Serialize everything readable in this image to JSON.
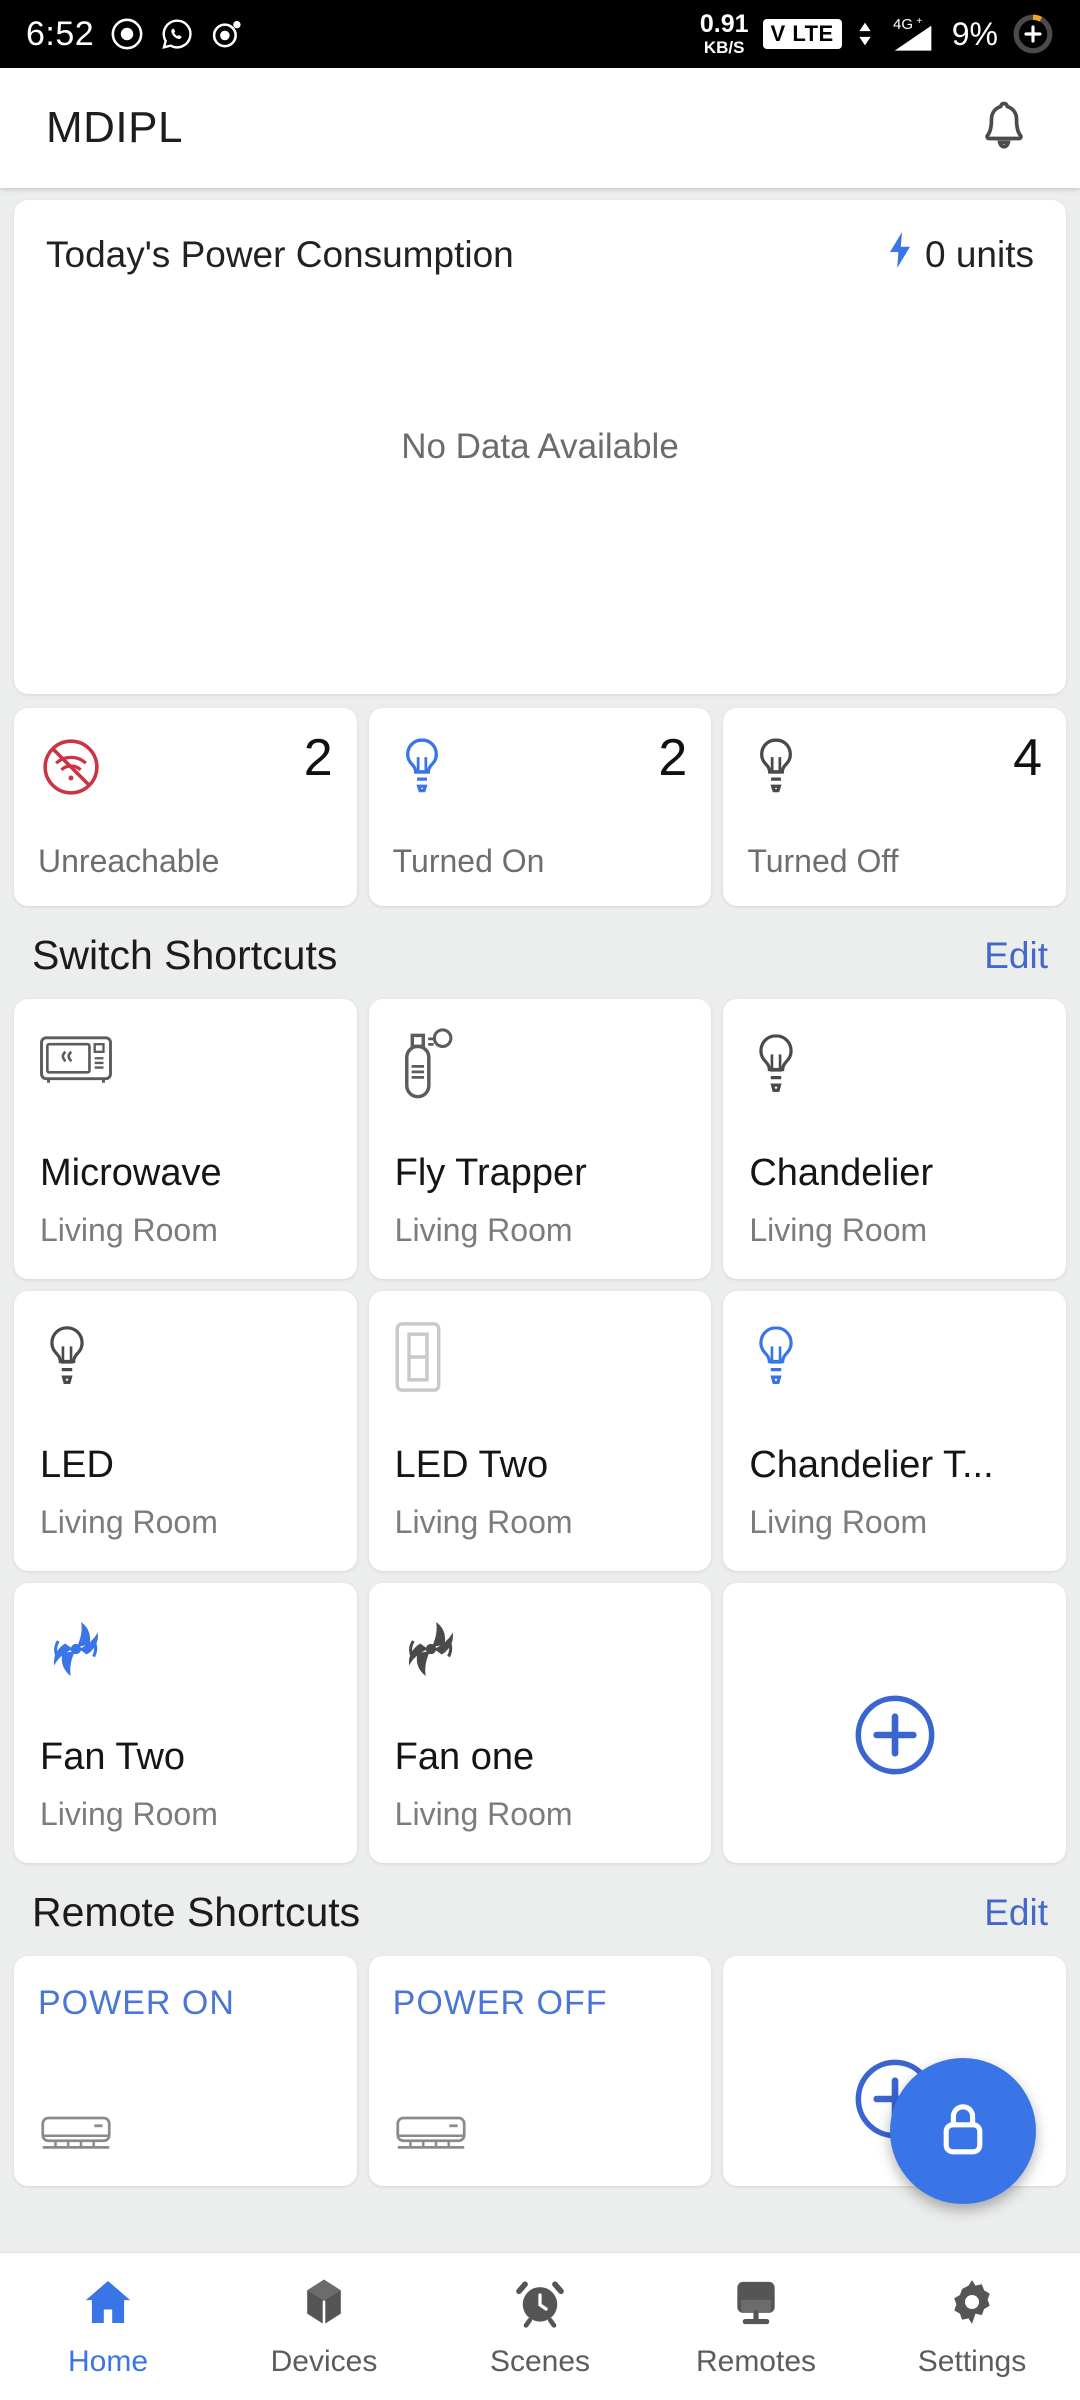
{
  "status_bar": {
    "time": "6:52",
    "net_speed_value": "0.91",
    "net_speed_unit": "KB/S",
    "volte": "V LTE",
    "network_type": "4G+",
    "battery_percent": "9%"
  },
  "app_bar": {
    "title": "MDIPL",
    "notification_icon": "bell-icon"
  },
  "power_card": {
    "title": "Today's Power Consumption",
    "units_value": "0 units",
    "bolt_icon": "lightning-bolt-icon",
    "empty_text": "No Data Available"
  },
  "status_cards": [
    {
      "count": "2",
      "label": "Unreachable",
      "icon": "wifi-off-icon",
      "color": "#cc3344"
    },
    {
      "count": "2",
      "label": "Turned On",
      "icon": "bulb-on-icon",
      "color": "#3a75e8"
    },
    {
      "count": "4",
      "label": "Turned Off",
      "icon": "bulb-off-icon",
      "color": "#4a4a4a"
    }
  ],
  "switch_section": {
    "title": "Switch Shortcuts",
    "edit_label": "Edit",
    "tiles": [
      {
        "name": "Microwave",
        "room": "Living Room",
        "icon": "microwave-icon",
        "color": "#5c5c5c"
      },
      {
        "name": "Fly Trapper",
        "room": "Living Room",
        "icon": "spray-can-icon",
        "color": "#5c5c5c"
      },
      {
        "name": "Chandelier",
        "room": "Living Room",
        "icon": "bulb-off-icon",
        "color": "#4a4a4a"
      },
      {
        "name": "LED",
        "room": "Living Room",
        "icon": "bulb-off-icon",
        "color": "#4a4a4a"
      },
      {
        "name": "LED Two",
        "room": "Living Room",
        "icon": "switch-plate-icon",
        "color": "#c9c9c9"
      },
      {
        "name": "Chandelier T...",
        "room": "Living Room",
        "icon": "bulb-on-icon",
        "color": "#3a75e8"
      },
      {
        "name": "Fan Two",
        "room": "Living Room",
        "icon": "fan-icon",
        "color": "#3a75e8"
      },
      {
        "name": "Fan one",
        "room": "Living Room",
        "icon": "fan-icon",
        "color": "#4a4a4a"
      }
    ],
    "add_icon": "plus-circle-icon"
  },
  "remote_section": {
    "title": "Remote Shortcuts",
    "edit_label": "Edit",
    "tiles": [
      {
        "label": "POWER ON",
        "icon": "air-conditioner-icon"
      },
      {
        "label": "POWER OFF",
        "icon": "air-conditioner-icon"
      }
    ],
    "add_icon": "plus-circle-icon"
  },
  "fab": {
    "icon": "lock-icon",
    "color": "#3a75e8"
  },
  "bottom_nav": {
    "active_index": 0,
    "items": [
      {
        "label": "Home",
        "icon": "home-icon"
      },
      {
        "label": "Devices",
        "icon": "cube-icon"
      },
      {
        "label": "Scenes",
        "icon": "alarm-clock-icon"
      },
      {
        "label": "Remotes",
        "icon": "monitor-icon"
      },
      {
        "label": "Settings",
        "icon": "gear-icon"
      }
    ]
  }
}
